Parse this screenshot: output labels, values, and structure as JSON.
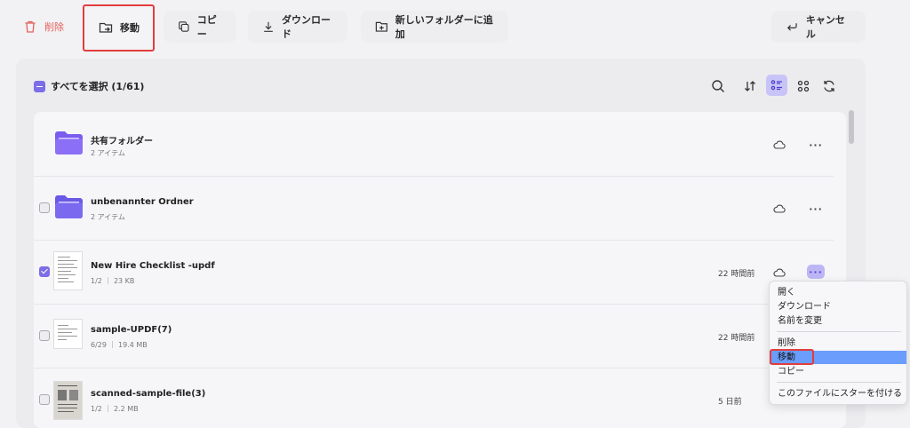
{
  "toolbar": {
    "delete_label": "削除",
    "move_label": "移動",
    "copy_label": "コピー",
    "download_label": "ダウンロード",
    "new_folder_label": "新しいフォルダーに追加",
    "cancel_label": "キャンセル"
  },
  "selection": {
    "select_all_label": "すべてを選択 (1/61)"
  },
  "files": [
    {
      "name": "共有フォルダー",
      "meta": "2 アイテム",
      "time": "",
      "type": "folder",
      "checked": false
    },
    {
      "name": "unbenannter Ordner",
      "meta": "2 アイテム",
      "time": "",
      "type": "folder",
      "checked": false
    },
    {
      "name": "New Hire Checklist -updf",
      "meta": "1/2 ｜ 23 KB",
      "time": "22 時間前",
      "type": "pdf",
      "checked": true
    },
    {
      "name": "sample-UPDF(7)",
      "meta": "6/29 ｜ 19.4 MB",
      "time": "22 時間前",
      "type": "pdf",
      "checked": false
    },
    {
      "name": "scanned-sample-file(3)",
      "meta": "1/2 ｜ 2.2 MB",
      "time": "5 日前",
      "type": "scan",
      "checked": false
    }
  ],
  "context_menu": {
    "items": [
      "開く",
      "ダウンロード",
      "名前を変更",
      "削除",
      "移動",
      "コピー",
      "このファイルにスターを付ける"
    ],
    "selected": "移動"
  },
  "colors": {
    "accent": "#7b6ee6",
    "danger": "#e3615a",
    "menu_selected": "#6a9dfc",
    "folder": "#7a5cf0",
    "highlight": "#e23d3d"
  }
}
